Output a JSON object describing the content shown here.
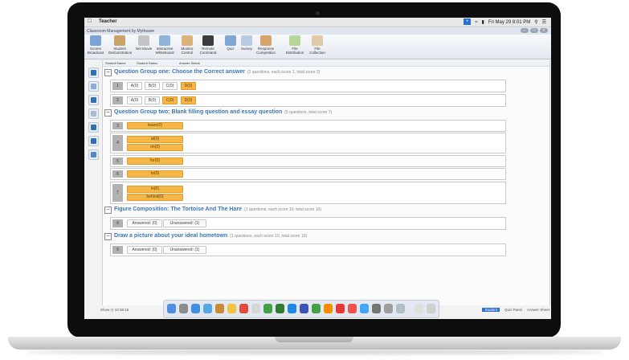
{
  "menubar": {
    "app": "Teacher",
    "datetime": "Fri May 29 8:01 PM"
  },
  "window": {
    "title": "Classroom Management by Mythware"
  },
  "toolbar": [
    "Screen Broadcast",
    "Student Demonstration",
    "Net Movie",
    "Interactive Whiteboard",
    "Monitor Control",
    "Remote Command",
    "Quiz",
    "Survey",
    "Response Competition",
    "File Distribution",
    "File Collection"
  ],
  "columns": [
    "Student Name",
    "Student Status",
    "Answer Status"
  ],
  "groups": [
    {
      "title": "Question Group one: Choose the Correct answer",
      "summary": "(2 questions, each score 1, total score 2)"
    },
    {
      "title": "Question Group two: Blank filling question and essay question",
      "summary": "(5 questions, total score 7)"
    },
    {
      "title": "Figure Composition: The Tortoise And The Hare",
      "summary": "(1 questions, each score 10, total score 10)"
    },
    {
      "title": "Draw a picture about your ideal hometown",
      "summary": "(1 questions, each score 10, total score 10)"
    }
  ],
  "q1": {
    "num": "1",
    "options": [
      "A(0)",
      "B(0)",
      "C(0)",
      "D(0)"
    ]
  },
  "q2": {
    "num": "2",
    "options": [
      "A(0)",
      "B(0)",
      "C(0)",
      "D(0)"
    ]
  },
  "q3": {
    "num": "3",
    "answers": [
      "leave(0)"
    ]
  },
  "q4": {
    "num": "4",
    "answers": [
      "at(0)",
      "on(0)"
    ]
  },
  "q5": {
    "num": "5",
    "answers": [
      "for(0)"
    ]
  },
  "q6": {
    "num": "6",
    "answers": [
      "to(0)"
    ]
  },
  "q7": {
    "num": "7",
    "answers": [
      "in(0)",
      "behind(0)"
    ]
  },
  "q8": {
    "num": "8",
    "answered": "Answered: (0)",
    "unanswered": "Unanswered: (1)"
  },
  "q9": {
    "num": "9",
    "answered": "Answered: (0)",
    "unanswered": "Unanswered: (1)"
  },
  "statusbar": {
    "left": "Show",
    "time": "10:38:15",
    "student": "Student",
    "quiz_panel": "Quiz Panel",
    "answer_sheet": "Answer Sheet"
  },
  "colors": {
    "selected": "#f5b74a",
    "group_title": "#3d78b8",
    "menubar_accent": "#2a6fd6"
  }
}
